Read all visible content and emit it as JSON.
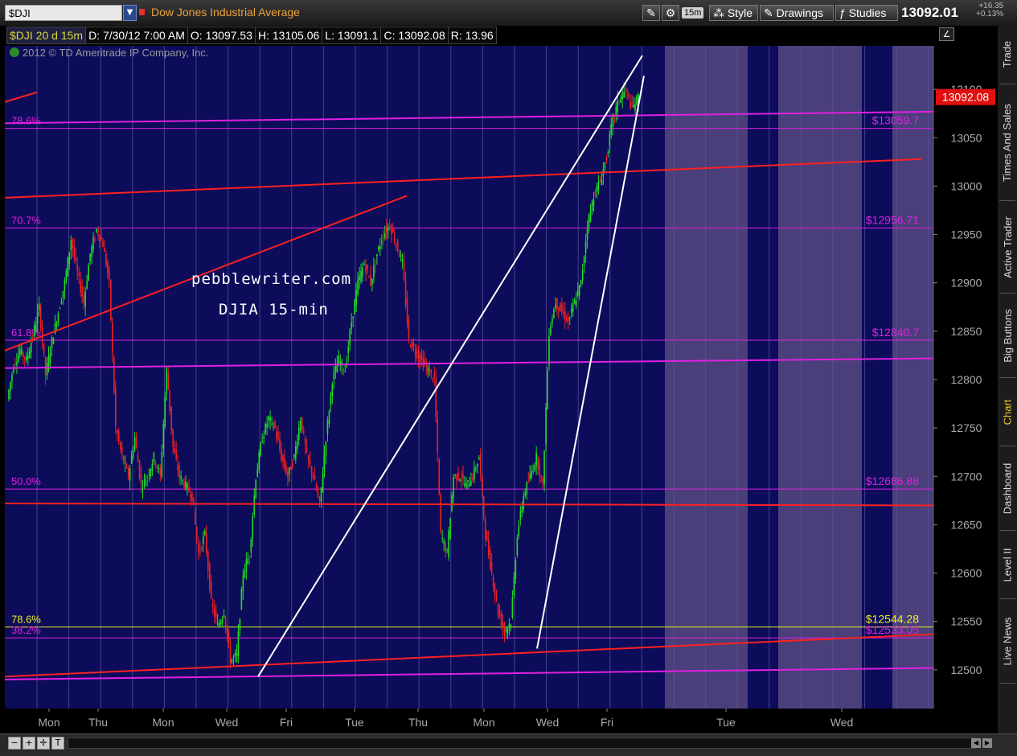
{
  "toolbar": {
    "symbol": "$DJI",
    "symbol_name": "Dow Jones Industrial Average",
    "timeframe": "15m",
    "style_label": "Style",
    "drawings_label": "Drawings",
    "studies_label": "Studies",
    "last_price": "13092.01",
    "change": "+16.35",
    "change_pct": "+0.13%"
  },
  "infobar": {
    "symbol": "$DJI 20 d 15m",
    "date": "D: 7/30/12 7:00 AM",
    "open": "O: 13097.53",
    "high": "H: 13105.06",
    "low": "L: 13091.1",
    "close": "C: 13092.08",
    "range": "R: 13.96"
  },
  "copyright": "2012 © TD Ameritrade IP Company, Inc.",
  "watermark": {
    "line1": "pebblewriter.com",
    "line2": "DJIA 15-min"
  },
  "side_tabs": [
    "Trade",
    "Times And Sales",
    "Active Trader",
    "Big Buttons",
    "Chart",
    "Dashboard",
    "Level II",
    "Live News"
  ],
  "chart_data": {
    "type": "candlestick",
    "title": "$DJI 20 d 15m",
    "ylim": [
      12460,
      13145
    ],
    "yticks": [
      12500,
      12550,
      12600,
      12650,
      12700,
      12750,
      12800,
      12850,
      12900,
      12950,
      13000,
      13050,
      13100
    ],
    "last_price_label": "13092.08",
    "xlabels": [
      "Mon",
      "Thu",
      "Mon",
      "Wed",
      "Fri",
      "Tue",
      "Thu",
      "Mon",
      "Wed",
      "Fri",
      "Tue",
      "Wed"
    ],
    "fib_levels": [
      {
        "pct": "78.6%",
        "price": 13059.7,
        "label": "$13059.7",
        "color": "#e020e0"
      },
      {
        "pct": "70.7%",
        "price": 12956.71,
        "label": "$12956.71",
        "color": "#e020e0"
      },
      {
        "pct": "61.8%",
        "price": 12840.7,
        "label": "$12840.7",
        "color": "#e020e0"
      },
      {
        "pct": "50.0%",
        "price": 12686.88,
        "label": "$12686.88",
        "color": "#e020e0"
      },
      {
        "pct": "78.6%",
        "price": 12544.28,
        "label": "$12544.28",
        "color": "#f0f020"
      },
      {
        "pct": "38.2%",
        "price": 12533.05,
        "label": "$12533.05",
        "color": "#e020e0"
      }
    ],
    "trend_lines": [
      {
        "color": "#e020e0",
        "p1": [
          0,
          13065
        ],
        "p2": [
          1161,
          13077
        ]
      },
      {
        "color": "#e020e0",
        "p1": [
          0,
          12812
        ],
        "p2": [
          1161,
          12822
        ]
      },
      {
        "color": "#e020e0",
        "p1": [
          0,
          12490
        ],
        "p2": [
          1161,
          12502
        ]
      },
      {
        "color": "#ff2020",
        "p1": [
          0,
          12988
        ],
        "p2": [
          1140,
          13028
        ]
      },
      {
        "color": "#ff2020",
        "p1": [
          0,
          12493
        ],
        "p2": [
          1161,
          12537
        ]
      },
      {
        "color": "#ff2020",
        "p1": [
          0,
          12672
        ],
        "p2": [
          1161,
          12670
        ]
      },
      {
        "color": "#ff2020",
        "p1": [
          0,
          12830
        ],
        "p2": [
          500,
          12990
        ]
      },
      {
        "color": "#ff2020",
        "p1": [
          0,
          13087
        ],
        "p2": [
          40,
          13097
        ]
      },
      {
        "color": "#ffffff",
        "p1": [
          315,
          12493
        ],
        "p2": [
          793,
          13135
        ]
      },
      {
        "color": "#ffffff",
        "p1": [
          662,
          12522
        ],
        "p2": [
          795,
          13114
        ]
      }
    ],
    "series": [
      12780,
      12815,
      12830,
      12820,
      12845,
      12875,
      12805,
      12840,
      12870,
      12900,
      12945,
      12910,
      12880,
      12930,
      12955,
      12940,
      12900,
      12750,
      12720,
      12700,
      12740,
      12690,
      12700,
      12720,
      12700,
      12810,
      12730,
      12700,
      12690,
      12680,
      12620,
      12640,
      12570,
      12545,
      12560,
      12510,
      12515,
      12600,
      12620,
      12700,
      12740,
      12760,
      12750,
      12720,
      12700,
      12720,
      12760,
      12720,
      12700,
      12670,
      12740,
      12800,
      12820,
      12810,
      12860,
      12900,
      12920,
      12900,
      12930,
      12950,
      12960,
      12940,
      12920,
      12840,
      12830,
      12820,
      12810,
      12800,
      12640,
      12620,
      12700,
      12700,
      12690,
      12700,
      12720,
      12640,
      12600,
      12560,
      12540,
      12550,
      12640,
      12680,
      12700,
      12720,
      12690,
      12850,
      12880,
      12870,
      12860,
      12880,
      12900,
      12960,
      12990,
      13005,
      13030,
      13070,
      13090,
      13100,
      13080,
      13092
    ]
  }
}
